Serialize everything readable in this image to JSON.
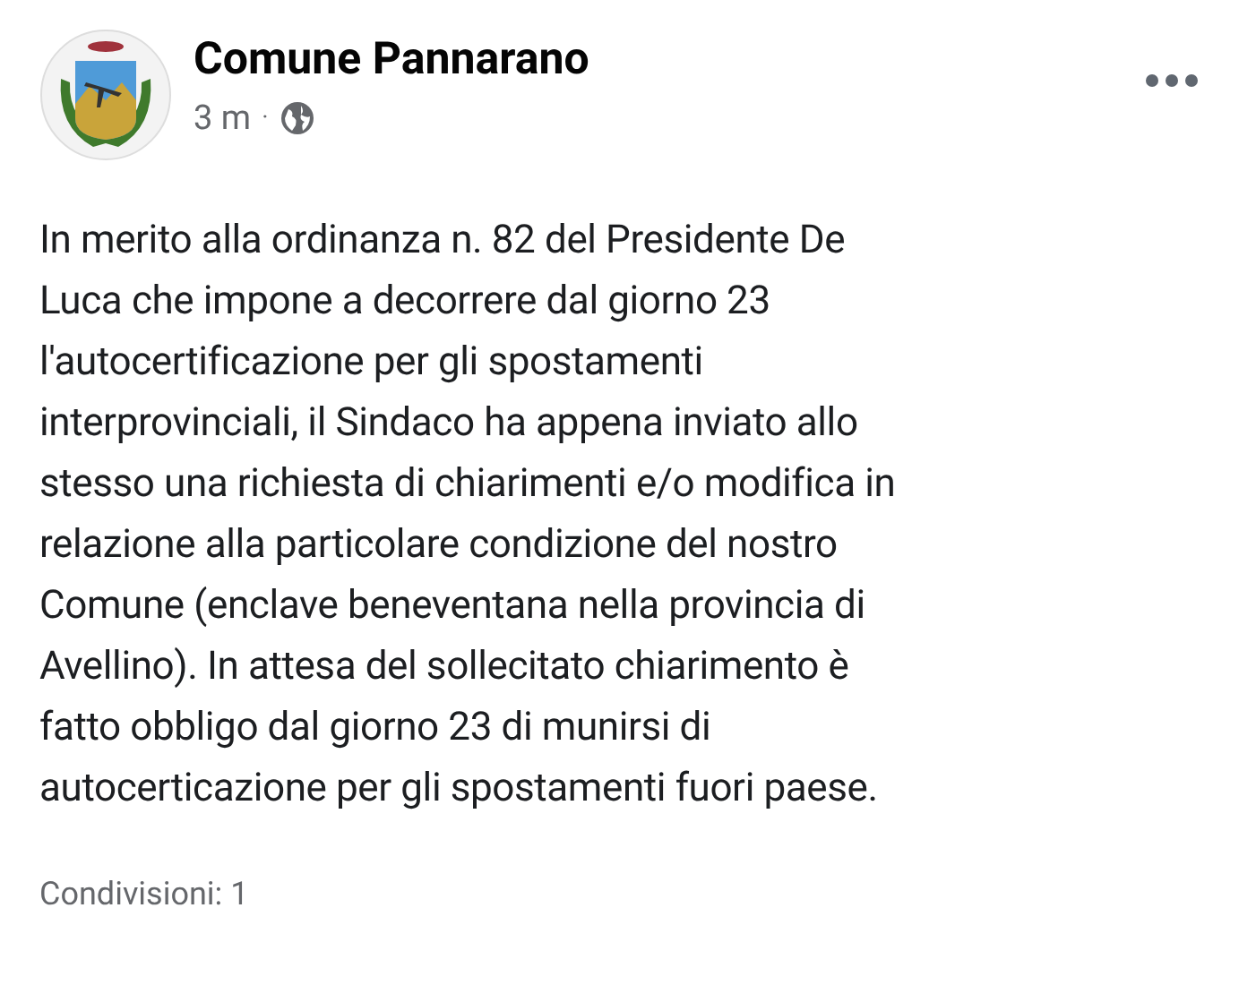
{
  "post": {
    "author": "Comune Pannarano",
    "time": "3 m",
    "separator": "·",
    "body_lines": [
      "In merito alla ordinanza n. 82 del Presidente De",
      "Luca che impone a decorrere dal giorno 23",
      "l'autocertificazione per gli spostamenti",
      "interprovinciali, il Sindaco ha appena inviato allo",
      "stesso una richiesta di chiarimenti e/o modifica in",
      "relazione alla particolare condizione del nostro",
      "Comune (enclave beneventana nella provincia di",
      "Avellino). In attesa del sollecitato chiarimento è",
      "fatto obbligo dal giorno 23 di munirsi di",
      "autocerticazione per gli spostamenti fuori paese."
    ],
    "shares": "Condivisioni: 1"
  }
}
